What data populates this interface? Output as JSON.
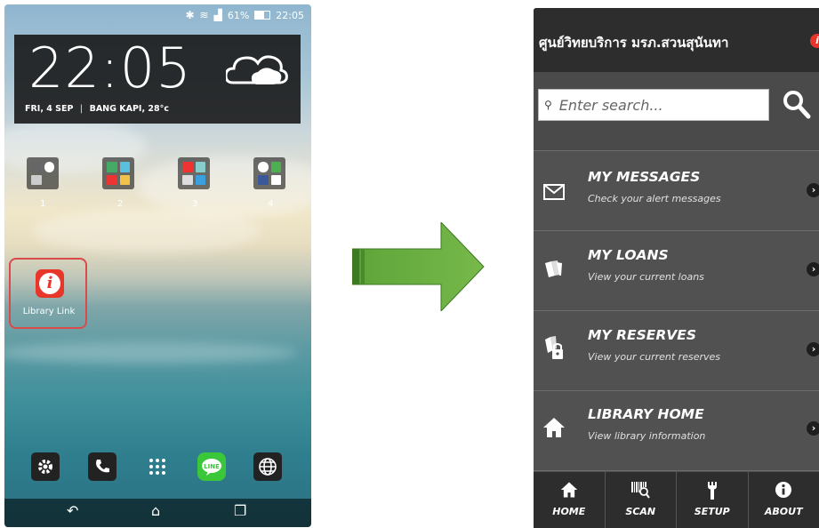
{
  "phone1": {
    "status": {
      "battery": "61%",
      "time": "22:05"
    },
    "clock": {
      "time": "22:05",
      "date": "FRI, 4 SEP",
      "location": "BANG KAPI, 28°c"
    },
    "folders": [
      {
        "label": "1"
      },
      {
        "label": "2"
      },
      {
        "label": "3"
      },
      {
        "label": "4"
      }
    ],
    "app_icon": {
      "label": "Library Link"
    },
    "dock": [
      "settings-icon",
      "phone-icon",
      "app-drawer-icon",
      "line-icon",
      "browser-icon"
    ],
    "nav": [
      "back-icon",
      "home-icon",
      "recents-icon"
    ]
  },
  "phone2": {
    "header": {
      "title": "ศูนย์วิทยบริการ มรภ.สวนสุนันทา"
    },
    "search": {
      "placeholder": "Enter search..."
    },
    "menu": [
      {
        "title": "MY MESSAGES",
        "subtitle": "Check your alert messages",
        "icon": "envelope-icon"
      },
      {
        "title": "MY LOANS",
        "subtitle": "View your current loans",
        "icon": "books-icon"
      },
      {
        "title": "MY RESERVES",
        "subtitle": "View your current reserves",
        "icon": "lock-books-icon"
      },
      {
        "title": "LIBRARY HOME",
        "subtitle": "View library information",
        "icon": "home-icon"
      }
    ],
    "tabs": [
      {
        "label": "HOME",
        "icon": "home-icon"
      },
      {
        "label": "SCAN",
        "icon": "barcode-icon"
      },
      {
        "label": "SETUP",
        "icon": "wrench-icon"
      },
      {
        "label": "ABOUT",
        "icon": "info-icon"
      }
    ]
  },
  "colors": {
    "arrow": "#6aaa3f",
    "brand_red": "#e8362b",
    "app_bg": "#515151",
    "header_bg": "#2d2d2d"
  }
}
